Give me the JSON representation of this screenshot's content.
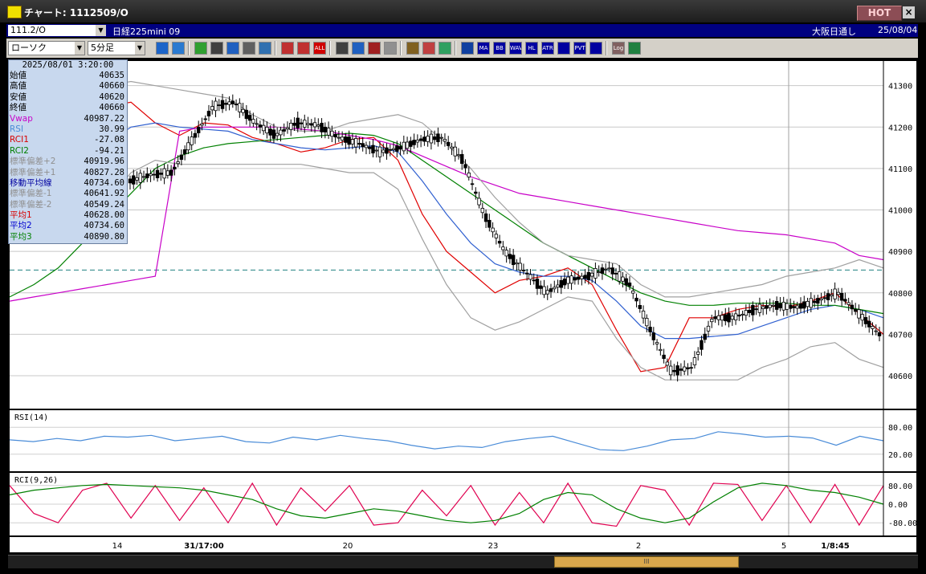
{
  "window": {
    "title": "チャート: 1112509/O",
    "hot_label": "HOT",
    "close_label": "×"
  },
  "info": {
    "code": "111.2/O",
    "instrument": "日経225mini 09",
    "exchange": "大阪日通し",
    "date": "25/08/04"
  },
  "toolbar": {
    "chart_type": "ローソク",
    "interval": "5分足",
    "icons": [
      "zoom-icon",
      "layout-icon",
      "draw-line-icon",
      "draw-tool-icon",
      "arrow-icon",
      "print-icon",
      "delete-icon",
      "indicator-a-icon",
      "indicator-b-icon",
      "all-icon",
      "cursor-icon",
      "search-icon",
      "crosshair-icon",
      "info-icon",
      "settings-icon",
      "pen-icon",
      "color-icon",
      "lines-icon",
      "ma-icon",
      "bb-icon",
      "wave-icon",
      "hl-icon",
      "atr-icon",
      "grid-icon",
      "pvt-icon",
      "box-icon",
      "log-icon",
      "export-icon"
    ],
    "labels": {
      "ma": "MA",
      "bb": "BB",
      "wave": "WAVE",
      "hl": "HL",
      "atr": "ATR",
      "pvt": "PVT",
      "all": "ALL",
      "log": "Log"
    }
  },
  "data_panel": {
    "datetime": "2025/08/01  3:20:00",
    "rows": [
      {
        "key": "始値",
        "value": "40635",
        "color": "#000000"
      },
      {
        "key": "高値",
        "value": "40660",
        "color": "#000000"
      },
      {
        "key": "安値",
        "value": "40620",
        "color": "#000000"
      },
      {
        "key": "終値",
        "value": "40660",
        "color": "#000000"
      },
      {
        "key": "Vwap",
        "value": "40987.22",
        "color": "#c800c8"
      },
      {
        "key": "RSI",
        "value": "30.99",
        "color": "#4a8cd8"
      },
      {
        "key": "RCI1",
        "value": "-27.08",
        "color": "#d80000"
      },
      {
        "key": "RCI2",
        "value": "-94.21",
        "color": "#008000"
      },
      {
        "key": "標準偏差+2",
        "value": "40919.96",
        "color": "#909090"
      },
      {
        "key": "標準偏差+1",
        "value": "40827.28",
        "color": "#909090"
      },
      {
        "key": "移動平均線",
        "value": "40734.60",
        "color": "#0000a0"
      },
      {
        "key": "標準偏差-1",
        "value": "40641.92",
        "color": "#909090"
      },
      {
        "key": "標準偏差-2",
        "value": "40549.24",
        "color": "#909090"
      },
      {
        "key": "平均1",
        "value": "40628.00",
        "color": "#d80000"
      },
      {
        "key": "平均2",
        "value": "40734.60",
        "color": "#0000d0"
      },
      {
        "key": "平均3",
        "value": "40890.80",
        "color": "#008000"
      }
    ]
  },
  "chart_data": [
    {
      "type": "line",
      "title": "",
      "ylim": [
        40540,
        41340
      ],
      "y_ticks": [
        "41300",
        "41200",
        "41100",
        "41000",
        "40900",
        "40800",
        "40700",
        "40600"
      ],
      "x_labels": [
        "14",
        "31/17:00",
        "20",
        "23",
        "2",
        "5",
        "1/8:45"
      ],
      "reference_price": 40855,
      "series": [
        {
          "name": "",
          "color": "#e00000",
          "values": [
            41070,
            41085,
            41090,
            41170,
            41250,
            41260,
            41210,
            41180,
            41210,
            41205,
            41175,
            41160,
            41140,
            41150,
            41170,
            41175,
            41120,
            40990,
            40900,
            40850,
            40800,
            40830,
            40840,
            40860,
            40820,
            40710,
            40610,
            40620,
            40740,
            40740,
            40760,
            40770,
            40765,
            40780,
            40800,
            40750,
            40700
          ]
        },
        {
          "name": "",
          "color": "#3060d0",
          "values": [
            41030,
            41050,
            41065,
            41110,
            41160,
            41200,
            41210,
            41200,
            41195,
            41190,
            41170,
            41160,
            41150,
            41145,
            41150,
            41155,
            41140,
            41070,
            40990,
            40920,
            40870,
            40850,
            40840,
            40840,
            40830,
            40780,
            40720,
            40690,
            40690,
            40695,
            40700,
            40720,
            40740,
            40760,
            40770,
            40760,
            40740
          ]
        },
        {
          "name": "",
          "color": "#008000",
          "values": [
            40790,
            40820,
            40860,
            40920,
            40980,
            41040,
            41100,
            41130,
            41150,
            41160,
            41165,
            41170,
            41175,
            41180,
            41185,
            41180,
            41160,
            41120,
            41080,
            41040,
            41000,
            40960,
            40920,
            40890,
            40860,
            40830,
            40800,
            40780,
            40770,
            40770,
            40775,
            40775,
            40775,
            40770,
            40770,
            40760,
            40750
          ]
        },
        {
          "name": "",
          "color": "#c800c8",
          "values": [
            40780,
            40790,
            40800,
            40810,
            40820,
            40830,
            40840,
            41190,
            41200,
            41200,
            41200,
            41200,
            41195,
            41190,
            41180,
            41170,
            41155,
            41130,
            41105,
            41080,
            41060,
            41040,
            41030,
            41020,
            41010,
            41000,
            40990,
            40980,
            40970,
            40960,
            40950,
            40945,
            40940,
            40930,
            40920,
            40890,
            40880
          ]
        },
        {
          "name": "",
          "color": "#a0a0a0",
          "values": [
            41110,
            41150,
            41180,
            41250,
            41300,
            41310,
            41300,
            41290,
            41280,
            41270,
            41230,
            41200,
            41190,
            41190,
            41210,
            41220,
            41230,
            41210,
            41160,
            41100,
            41030,
            40970,
            40920,
            40890,
            40880,
            40870,
            40820,
            40790,
            40790,
            40800,
            40810,
            40820,
            40840,
            40850,
            40860,
            40880,
            40860
          ]
        },
        {
          "name": "",
          "color": "#a0a0a0",
          "values": [
            40950,
            40950,
            40950,
            40970,
            41020,
            41090,
            41120,
            41110,
            41110,
            41110,
            41110,
            41110,
            41110,
            41100,
            41090,
            41090,
            41050,
            40930,
            40820,
            40740,
            40710,
            40730,
            40760,
            40790,
            40780,
            40690,
            40620,
            40590,
            40590,
            40590,
            40590,
            40620,
            40640,
            40670,
            40680,
            40640,
            40620
          ]
        }
      ]
    },
    {
      "type": "line",
      "title": "RSI(14)",
      "ylim": [
        0,
        100
      ],
      "y_ticks": [
        "80.00",
        "20.00"
      ],
      "series": [
        {
          "name": "",
          "color": "#4a8cd8",
          "values": [
            52,
            48,
            55,
            50,
            60,
            58,
            62,
            50,
            55,
            60,
            48,
            45,
            58,
            52,
            62,
            55,
            50,
            40,
            32,
            38,
            35,
            48,
            55,
            60,
            45,
            30,
            28,
            38,
            52,
            55,
            70,
            65,
            58,
            60,
            56,
            40,
            60,
            50
          ]
        }
      ]
    },
    {
      "type": "line",
      "title": "RCI(9,26)",
      "ylim": [
        -100,
        100
      ],
      "y_ticks": [
        "80.00",
        "0.00",
        "-80.00"
      ],
      "series": [
        {
          "name": "",
          "color": "#e00050",
          "values": [
            80,
            -40,
            -80,
            60,
            90,
            -60,
            80,
            -70,
            70,
            -80,
            90,
            -90,
            70,
            -30,
            80,
            -90,
            -80,
            60,
            -50,
            80,
            -90,
            50,
            -80,
            90,
            -80,
            -95,
            80,
            60,
            -90,
            90,
            85,
            -70,
            80,
            -80,
            85,
            -90,
            80
          ]
        },
        {
          "name": "",
          "color": "#008000",
          "values": [
            40,
            60,
            70,
            80,
            85,
            80,
            75,
            70,
            60,
            40,
            20,
            -20,
            -50,
            -60,
            -40,
            -20,
            -30,
            -50,
            -70,
            -80,
            -70,
            -40,
            20,
            50,
            40,
            -20,
            -60,
            -80,
            -60,
            10,
            70,
            90,
            80,
            60,
            50,
            30,
            0
          ]
        }
      ]
    }
  ],
  "scrollbar": {
    "thumb_label": "III"
  }
}
